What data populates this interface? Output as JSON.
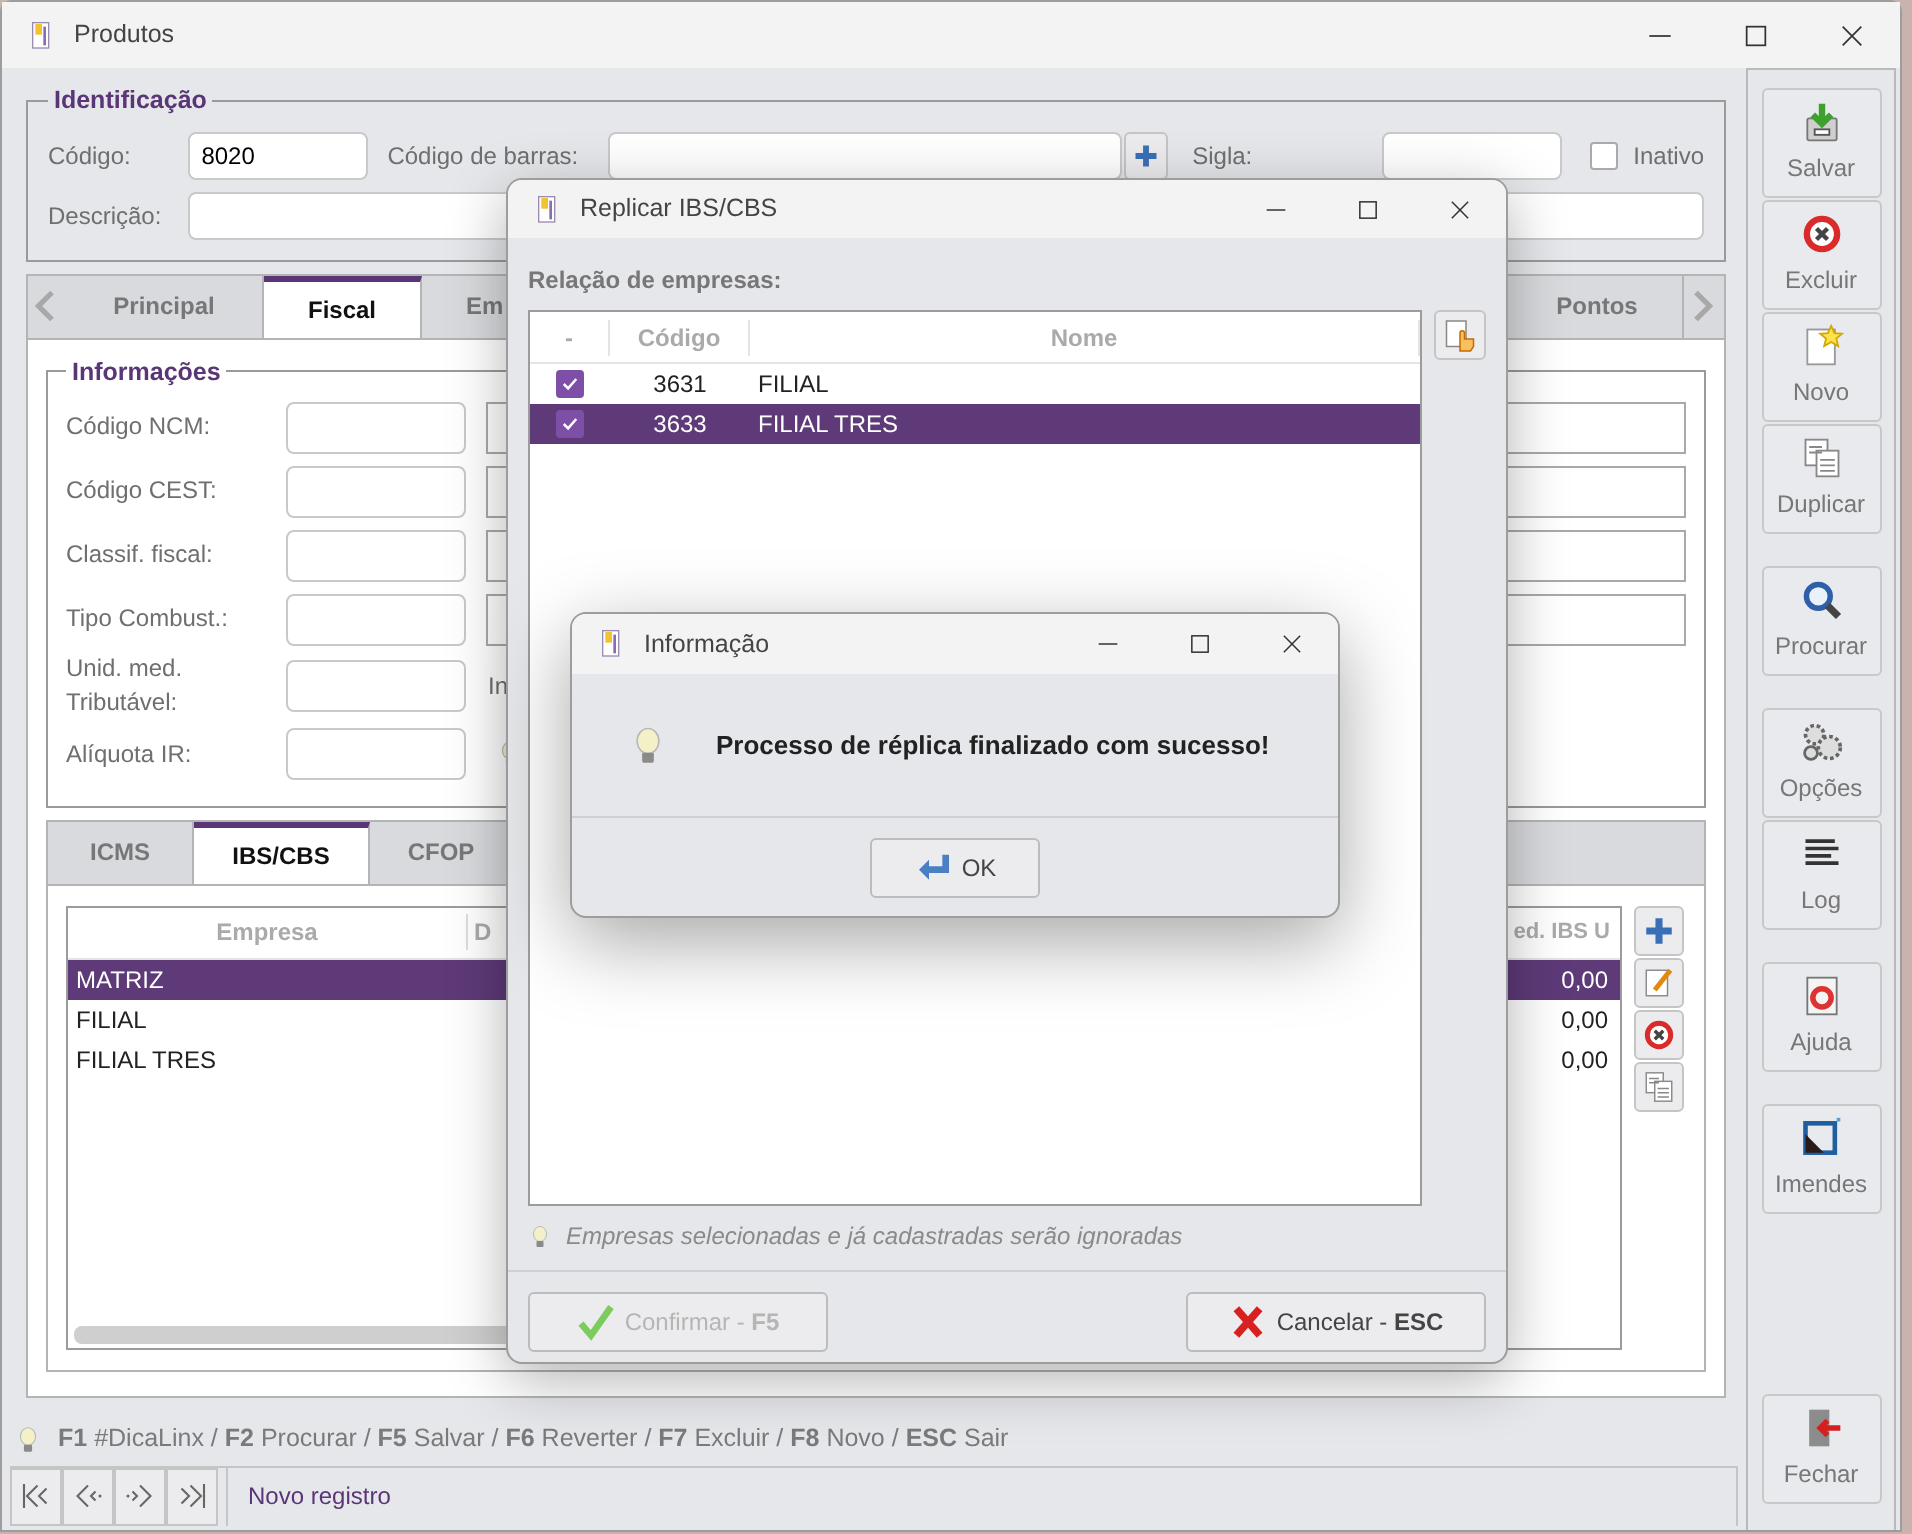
{
  "window": {
    "title": "Produtos"
  },
  "identification": {
    "legend": "Identificação",
    "code_label": "Código:",
    "code_value": "8020",
    "barcode_label": "Código de barras:",
    "sigla_label": "Sigla:",
    "inativo": {
      "label": "Inativo",
      "checked": false
    },
    "description_label": "Descrição:"
  },
  "tabs": [
    {
      "label": "Principal",
      "selected": false
    },
    {
      "label": "Fiscal",
      "selected": true
    },
    {
      "label": "Em",
      "selected": false
    },
    {
      "label": "Pontos",
      "selected": false
    }
  ],
  "informacoes": {
    "legend": "Informações",
    "rows": [
      {
        "label": "Código NCM:",
        "kind": "field"
      },
      {
        "label": "Código CEST:",
        "kind": "field"
      },
      {
        "label": "Classif. fiscal:",
        "kind": "field"
      },
      {
        "label": "Tipo Combust.:",
        "kind": "field"
      },
      {
        "label": "Unid. med. Tributável:",
        "kind": "note",
        "note": "In"
      },
      {
        "label": "Alíquota IR:",
        "kind": "hint"
      }
    ]
  },
  "subtabs": [
    {
      "label": "ICMS",
      "selected": false
    },
    {
      "label": "IBS/CBS",
      "selected": true
    },
    {
      "label": "CFOP",
      "selected": false
    }
  ],
  "grid": {
    "columns": [
      "Empresa",
      "D",
      "ed. IBS U"
    ],
    "rows": [
      {
        "empresa": "MATRIZ",
        "red_ibs": "0,00",
        "selected": true
      },
      {
        "empresa": "FILIAL",
        "red_ibs": "0,00",
        "selected": false
      },
      {
        "empresa": "FILIAL TRES",
        "red_ibs": "0,00",
        "selected": false
      }
    ]
  },
  "hint_bar": "**F1** #DicaLinx / **F2** Procurar / **F5** Salvar / **F6** Reverter / **F7** Excluir / **F8** Novo / **ESC** Sair",
  "status": "Novo registro",
  "toolbar": [
    [
      "Salvar",
      "Excluir",
      "Novo",
      "Duplicar"
    ],
    [
      "Procurar"
    ],
    [
      "Opções",
      "Log"
    ],
    [
      "Ajuda"
    ],
    [
      "Imendes"
    ],
    [
      "Fechar"
    ]
  ],
  "replicate_dialog": {
    "title": "Replicar IBS/CBS",
    "list_label": "Relação de empresas:",
    "columns": [
      "-",
      "Código",
      "Nome"
    ],
    "rows": [
      {
        "checked": true,
        "code": "3631",
        "name": "FILIAL",
        "selected": false
      },
      {
        "checked": true,
        "code": "3633",
        "name": "FILIAL TRES",
        "selected": true
      }
    ],
    "hint": "Empresas selecionadas e já cadastradas serão ignoradas",
    "confirm": {
      "label": "Confirmar - **F5**",
      "disabled": true
    },
    "cancel": {
      "label": "Cancelar - **ESC**",
      "disabled": false
    }
  },
  "info_dialog": {
    "title": "Informação",
    "message": "Processo de réplica finalizado com sucesso!",
    "ok": "OK"
  }
}
